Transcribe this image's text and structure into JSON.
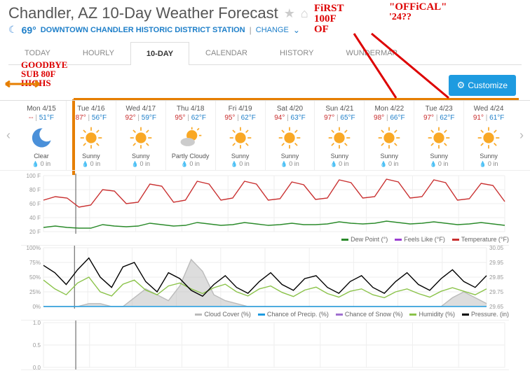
{
  "header": {
    "title": "Chandler, AZ 10-Day Weather Forecast",
    "temp_now": "69°",
    "station": "DOWNTOWN CHANDLER HISTORIC DISTRICT STATION",
    "change": "CHANGE"
  },
  "tabs": [
    "TODAY",
    "HOURLY",
    "10-DAY",
    "CALENDAR",
    "HISTORY",
    "WUNDERMAP"
  ],
  "active_tab": 2,
  "customize": "Customize",
  "days": [
    {
      "date": "Mon 4/15",
      "hi": "--",
      "lo": "51°F",
      "cond": "Clear",
      "precip": "0 in",
      "icon": "moon"
    },
    {
      "date": "Tue 4/16",
      "hi": "87°",
      "lo": "56°F",
      "cond": "Sunny",
      "precip": "0 in",
      "icon": "sun"
    },
    {
      "date": "Wed 4/17",
      "hi": "92°",
      "lo": "59°F",
      "cond": "Sunny",
      "precip": "0 in",
      "icon": "sun"
    },
    {
      "date": "Thu 4/18",
      "hi": "95°",
      "lo": "62°F",
      "cond": "Partly Cloudy",
      "precip": "0 in",
      "icon": "partly"
    },
    {
      "date": "Fri 4/19",
      "hi": "95°",
      "lo": "62°F",
      "cond": "Sunny",
      "precip": "0 in",
      "icon": "sun"
    },
    {
      "date": "Sat 4/20",
      "hi": "94°",
      "lo": "63°F",
      "cond": "Sunny",
      "precip": "0 in",
      "icon": "sun"
    },
    {
      "date": "Sun 4/21",
      "hi": "97°",
      "lo": "65°F",
      "cond": "Sunny",
      "precip": "0 in",
      "icon": "sun"
    },
    {
      "date": "Mon 4/22",
      "hi": "98°",
      "lo": "66°F",
      "cond": "Sunny",
      "precip": "0 in",
      "icon": "sun"
    },
    {
      "date": "Tue 4/23",
      "hi": "97°",
      "lo": "62°F",
      "cond": "Sunny",
      "precip": "0 in",
      "icon": "sun"
    },
    {
      "date": "Wed 4/24",
      "hi": "91°",
      "lo": "61°F",
      "cond": "Sunny",
      "precip": "0 in",
      "icon": "sun"
    }
  ],
  "legend1": [
    {
      "label": "Dew Point (°)",
      "color": "#2a8a2a"
    },
    {
      "label": "Feels Like (°F)",
      "color": "#9b3fd1"
    },
    {
      "label": "Temperature (°F)",
      "color": "#c93030"
    }
  ],
  "legend2": [
    {
      "label": "Cloud Cover (%)",
      "color": "#bbb"
    },
    {
      "label": "Chance of Precip. (%)",
      "color": "#1e9be0"
    },
    {
      "label": "Chance of Snow (%)",
      "color": "#a070d0"
    },
    {
      "label": "Humidity (%)",
      "color": "#8bc34a"
    },
    {
      "label": "Pressure. (in)",
      "color": "#000"
    }
  ],
  "chart_data": {
    "type": "line",
    "x_days": 10,
    "chart1": {
      "ylim": [
        20,
        100
      ],
      "yticks": [
        20,
        40,
        60,
        80,
        100
      ],
      "yticklabels": [
        "20 F",
        "40 F",
        "60 F",
        "80 F",
        "100 F"
      ],
      "series": [
        {
          "name": "Temperature",
          "color": "#c93030",
          "values": [
            65,
            70,
            68,
            55,
            58,
            80,
            78,
            60,
            62,
            88,
            85,
            62,
            65,
            92,
            88,
            65,
            68,
            92,
            88,
            65,
            67,
            91,
            87,
            66,
            68,
            94,
            90,
            68,
            70,
            95,
            91,
            68,
            70,
            94,
            90,
            65,
            67,
            89,
            86,
            63
          ]
        },
        {
          "name": "Dew Point",
          "color": "#2a8a2a",
          "values": [
            26,
            28,
            26,
            25,
            25,
            30,
            28,
            27,
            28,
            32,
            30,
            28,
            29,
            33,
            31,
            29,
            30,
            33,
            31,
            29,
            30,
            32,
            30,
            30,
            31,
            34,
            32,
            31,
            32,
            35,
            33,
            31,
            32,
            34,
            32,
            30,
            31,
            33,
            31,
            29
          ]
        }
      ]
    },
    "chart2": {
      "ylim_left": [
        0,
        100
      ],
      "yticks_left": [
        0,
        25,
        50,
        75,
        100
      ],
      "yticklabels_left": [
        "0%",
        "25%",
        "50%",
        "75%",
        "100%"
      ],
      "ylim_right": [
        29.65,
        30.05
      ],
      "yticks_right": [
        29.65,
        29.75,
        29.85,
        29.95,
        30.05
      ],
      "series": [
        {
          "name": "Cloud Cover",
          "color": "#bbb",
          "fill": true,
          "values": [
            0,
            0,
            0,
            0,
            5,
            5,
            0,
            0,
            15,
            30,
            20,
            10,
            35,
            80,
            60,
            20,
            10,
            5,
            0,
            0,
            0,
            0,
            0,
            0,
            0,
            0,
            0,
            0,
            0,
            0,
            0,
            0,
            0,
            0,
            0,
            0,
            15,
            25,
            15,
            5
          ]
        },
        {
          "name": "Chance of Precip.",
          "color": "#1e9be0",
          "values": [
            0,
            0,
            0,
            0,
            0,
            0,
            0,
            0,
            0,
            0,
            0,
            0,
            0,
            0,
            0,
            0,
            0,
            0,
            0,
            0,
            0,
            0,
            0,
            0,
            0,
            0,
            0,
            0,
            0,
            0,
            0,
            0,
            0,
            0,
            0,
            0,
            0,
            0,
            0,
            0
          ]
        },
        {
          "name": "Humidity",
          "color": "#8bc34a",
          "values": [
            45,
            30,
            20,
            40,
            50,
            25,
            18,
            38,
            45,
            28,
            20,
            35,
            40,
            30,
            22,
            32,
            38,
            25,
            18,
            30,
            35,
            24,
            17,
            28,
            33,
            22,
            16,
            26,
            30,
            20,
            15,
            25,
            30,
            22,
            16,
            26,
            32,
            26,
            20,
            30
          ]
        },
        {
          "name": "Pressure",
          "color": "#000",
          "axis": "right",
          "values": [
            29.93,
            29.88,
            29.8,
            29.9,
            29.98,
            29.85,
            29.78,
            29.92,
            29.95,
            29.82,
            29.75,
            29.88,
            29.84,
            29.76,
            29.72,
            29.8,
            29.86,
            29.78,
            29.74,
            29.82,
            29.88,
            29.8,
            29.76,
            29.84,
            29.86,
            29.78,
            29.74,
            29.82,
            29.86,
            29.78,
            29.74,
            29.82,
            29.88,
            29.8,
            29.76,
            29.84,
            29.9,
            29.82,
            29.78,
            29.86
          ]
        }
      ]
    },
    "chart3": {
      "ylim": [
        0,
        1
      ],
      "yticks": [
        0,
        0.5,
        1
      ],
      "yticklabels": [
        "0.0",
        "0.5",
        "1.0"
      ]
    }
  },
  "annotations": {
    "a1": "GOODBYE SUB 80F HIGHS",
    "a2": "FIRST 100F OF '24??",
    "a3": "\"OFFICAL\""
  }
}
